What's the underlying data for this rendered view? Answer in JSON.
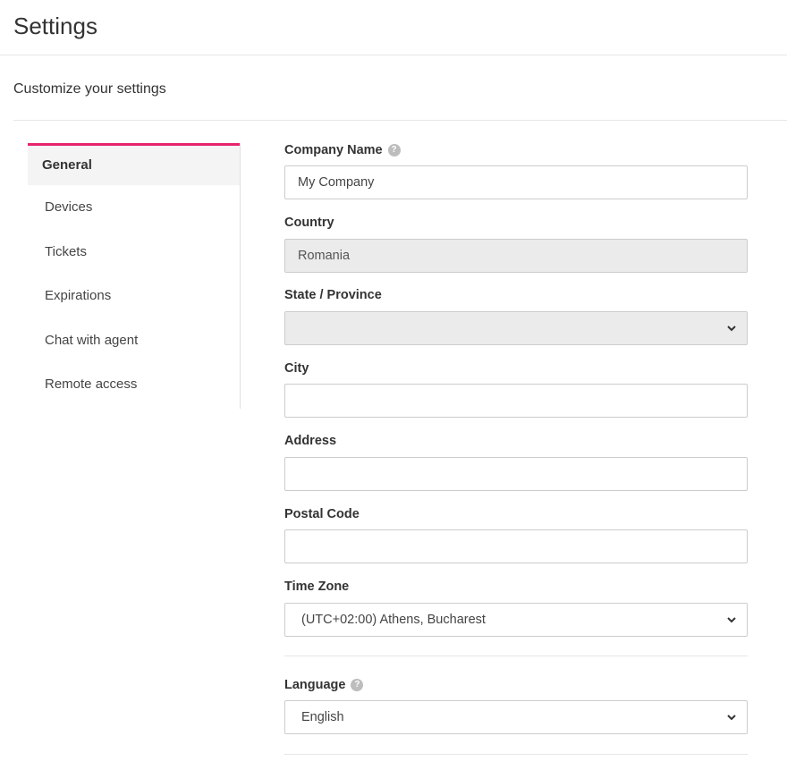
{
  "header": {
    "title": "Settings",
    "subtitle": "Customize your settings"
  },
  "sidebar": {
    "items": [
      {
        "label": "General",
        "active": true
      },
      {
        "label": "Devices"
      },
      {
        "label": "Tickets"
      },
      {
        "label": "Expirations"
      },
      {
        "label": "Chat with agent"
      },
      {
        "label": "Remote access"
      }
    ]
  },
  "form": {
    "company_name": {
      "label": "Company Name",
      "value": "My Company",
      "help_icon": "question-circle-icon"
    },
    "country": {
      "label": "Country",
      "value": "Romania"
    },
    "state": {
      "label": "State / Province",
      "value": ""
    },
    "city": {
      "label": "City",
      "value": ""
    },
    "address": {
      "label": "Address",
      "value": ""
    },
    "postal_code": {
      "label": "Postal Code",
      "value": ""
    },
    "time_zone": {
      "label": "Time Zone",
      "value": "(UTC+02:00) Athens, Bucharest"
    },
    "language": {
      "label": "Language",
      "value": "English",
      "help_icon": "question-circle-icon"
    }
  },
  "colors": {
    "accent": "#e6246f",
    "disabled_bg": "#ebebeb",
    "border": "#cccccc"
  }
}
